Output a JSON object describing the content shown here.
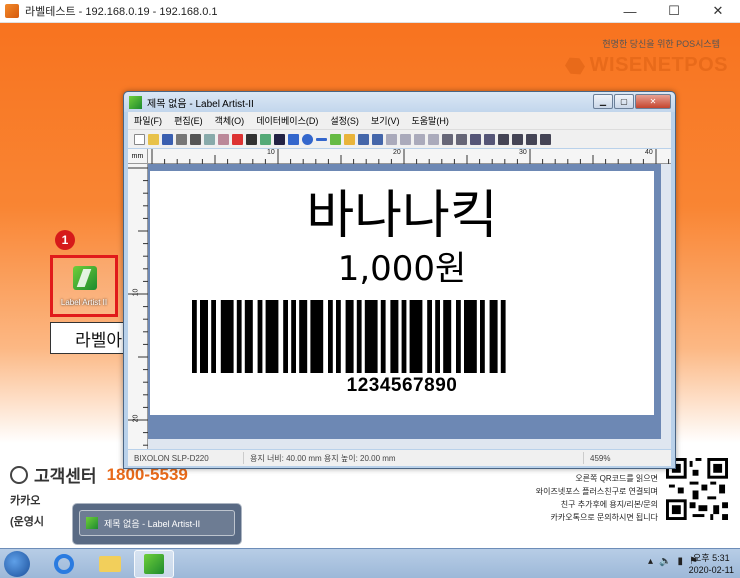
{
  "window": {
    "title": "라벨테스트 - 192.168.0.19 - 192.168.0.1",
    "minimize": "—",
    "maximize": "☐",
    "close": "✕"
  },
  "brand": {
    "tagline": "현명한 당신을 위한 POS시스템",
    "name": "WISENETPOS"
  },
  "step": {
    "number": "1",
    "callout": "라벨아티스트 실행",
    "icon_label": "Label Artist II"
  },
  "contact": {
    "title": "고객센터",
    "phone": "1800-5539",
    "line1": "카카오",
    "line2": "(운영시"
  },
  "qr_text": [
    "오른쪽 QR코드를 읽으면",
    "와이즈넷포스 플러스친구로 연결되며",
    "친구 추가후에 용지/리본/문의",
    "카카오톡으로 문의하시면 됩니다"
  ],
  "app": {
    "title": "제목 없음 - Label Artist-II",
    "menu": [
      "파일(F)",
      "편집(E)",
      "객체(O)",
      "데이터베이스(D)",
      "설정(S)",
      "보기(V)",
      "도움말(H)"
    ],
    "ruler_unit": "mm",
    "ruler_top": [
      "10",
      "20",
      "30",
      "40"
    ],
    "ruler_left": [
      "10",
      "20"
    ],
    "label": {
      "title": "바나나킥",
      "price": "1,000원",
      "barcode": "1234567890"
    },
    "status": {
      "printer": "BIXOLON SLP-D220",
      "size": "용지 너비: 40.00 mm 용지 높이: 20.00 mm",
      "zoom": "459%"
    }
  },
  "taskbar": {
    "thumbnail_title": "제목 없음 - Label Artist-II",
    "time": "오후 5:31",
    "date": "2020-02-11"
  },
  "colors": {
    "accent": "#e86a1a",
    "highlight": "#e11b1b"
  }
}
